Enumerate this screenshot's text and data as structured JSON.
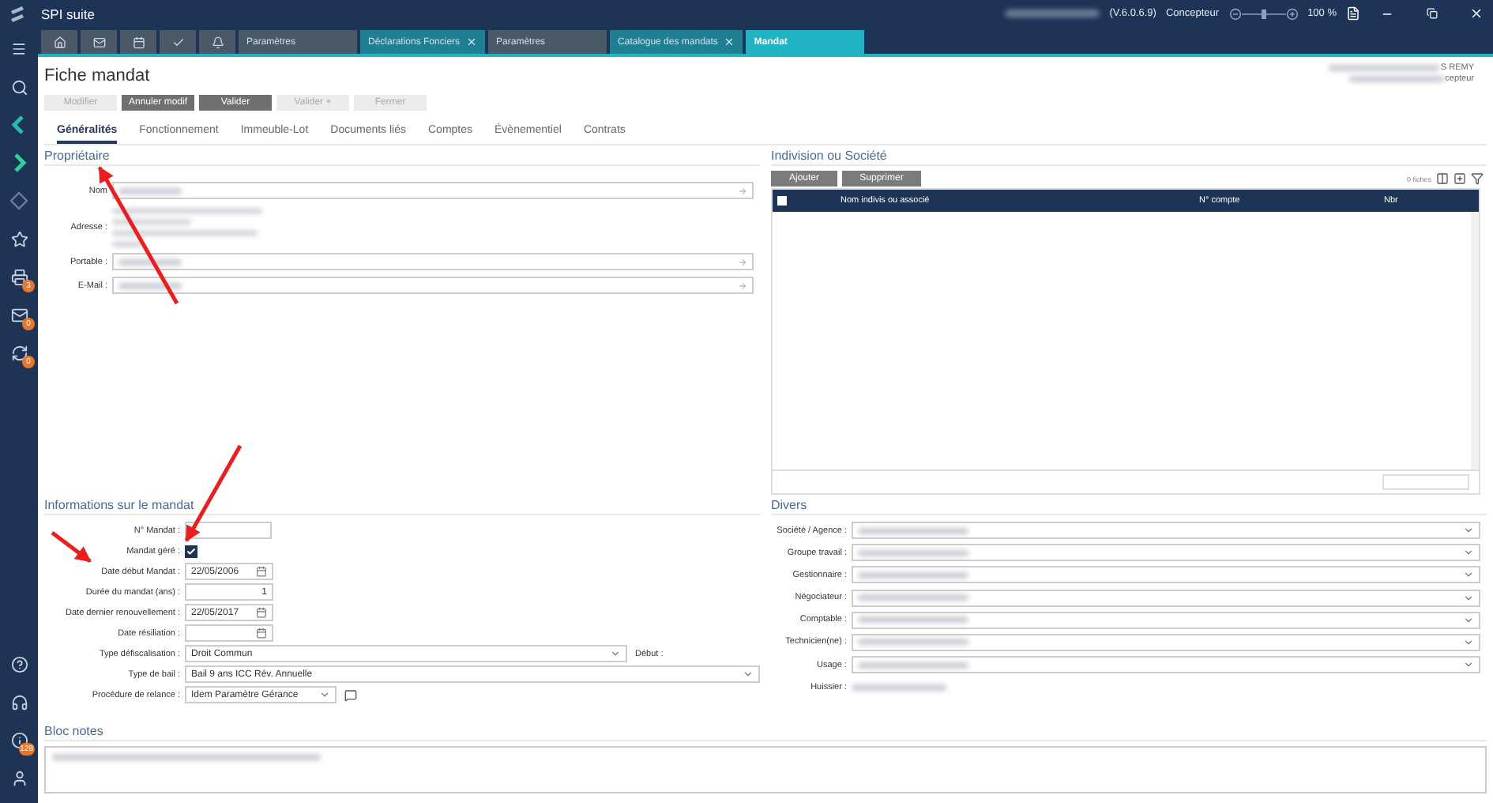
{
  "window": {
    "app_name": "SPI suite",
    "version": "(V.6.0.6.9)",
    "role": "Concepteur",
    "zoom": "100 %",
    "zoom_slider": {
      "level": 0.5
    }
  },
  "sidebar": {
    "badges": [
      "3",
      "0",
      "0"
    ],
    "bottom_badges": [
      "128"
    ]
  },
  "nav_tabs": [
    {
      "kind": "icon",
      "selected": false
    },
    {
      "kind": "icon",
      "selected": false
    },
    {
      "kind": "icon",
      "selected": false
    },
    {
      "kind": "icon",
      "selected": false
    },
    {
      "kind": "icon",
      "selected": false
    },
    {
      "kind": "text",
      "label": "Paramètres",
      "closable": false,
      "selected": false,
      "color": "#4a5868"
    },
    {
      "kind": "text",
      "label": "Déclarations Fonciers",
      "closable": true,
      "selected": false,
      "color": "#1f7f93"
    },
    {
      "kind": "text",
      "label": "Paramètres",
      "closable": false,
      "selected": false,
      "color": "#4a5868"
    },
    {
      "kind": "text",
      "label": "Catalogue des mandats",
      "closable": true,
      "selected": false,
      "color": "#1f7f93"
    },
    {
      "kind": "text",
      "label": "Mandat",
      "closable": false,
      "selected": true,
      "color": "#1fb3c4"
    }
  ],
  "page": {
    "title": "Fiche mandat",
    "user_lines": [
      "S REMY",
      "cepteur"
    ]
  },
  "actions": [
    {
      "label": "Modifier",
      "disabled": true
    },
    {
      "label": "Annuler modif",
      "disabled": false
    },
    {
      "label": "Valider",
      "disabled": false
    },
    {
      "label": "Valider +",
      "disabled": true
    },
    {
      "label": "Fermer",
      "disabled": true
    }
  ],
  "tabs": [
    {
      "label": "Généralités",
      "selected": true
    },
    {
      "label": "Fonctionnement",
      "selected": false
    },
    {
      "label": "Immeuble-Lot",
      "selected": false
    },
    {
      "label": "Documents liés",
      "selected": false
    },
    {
      "label": "Comptes",
      "selected": false
    },
    {
      "label": "Évènementiel",
      "selected": false
    },
    {
      "label": "Contrats",
      "selected": false
    }
  ],
  "owner": {
    "title": "Propriétaire",
    "fields": [
      {
        "kind": "line",
        "label": "Nom"
      },
      {
        "kind": "address",
        "label": "Adresse :"
      },
      {
        "kind": "line",
        "label": "Portable :"
      },
      {
        "kind": "line",
        "label": "E-Mail :"
      }
    ]
  },
  "association": {
    "title": "Indivision ou Société",
    "buttons": [
      "Ajouter",
      "Supprimer"
    ],
    "count": "0 fiches",
    "select_all_checked": false,
    "columns": [
      "Nom indivis ou associé",
      "N° compte",
      "Nbr"
    ]
  },
  "mandate": {
    "title": "Informations sur le mandat",
    "fields": [
      {
        "kind": "text",
        "label": "N° Mandat :"
      },
      {
        "kind": "checkbox",
        "label": "Mandat géré :",
        "checked": true
      },
      {
        "kind": "date",
        "label": "Date début Mandat :",
        "value": "22/05/2006"
      },
      {
        "kind": "number",
        "label": "Durée du mandat (ans) :",
        "value": "1"
      },
      {
        "kind": "date",
        "label": "Date dernier renouvellement :",
        "value": "22/05/2017"
      },
      {
        "kind": "date",
        "label": "Date résiliation :"
      },
      {
        "kind": "select",
        "label": "Type défiscalisation :",
        "value": "Droit Commun",
        "after": "Début :"
      },
      {
        "kind": "select",
        "label": "Type de bail :",
        "value": "Bail 9 ans ICC Rév. Annuelle"
      },
      {
        "kind": "select",
        "label": "Procédure de relance :",
        "value": "Idem Paramètre Gérance",
        "comment": true
      }
    ]
  },
  "misc": {
    "title": "Divers",
    "fields": [
      {
        "kind": "select",
        "label": "Société / Agence :"
      },
      {
        "kind": "select",
        "label": "Groupe travail :"
      },
      {
        "kind": "select",
        "label": "Gestionnaire :"
      },
      {
        "kind": "select",
        "label": "Négociateur :"
      },
      {
        "kind": "select",
        "label": "Comptable :"
      },
      {
        "kind": "select",
        "label": "Technicien(ne) :"
      },
      {
        "kind": "select",
        "label": "Usage :"
      },
      {
        "kind": "text",
        "label": "Huissier :"
      }
    ]
  },
  "notes": {
    "title": "Bloc notes"
  }
}
